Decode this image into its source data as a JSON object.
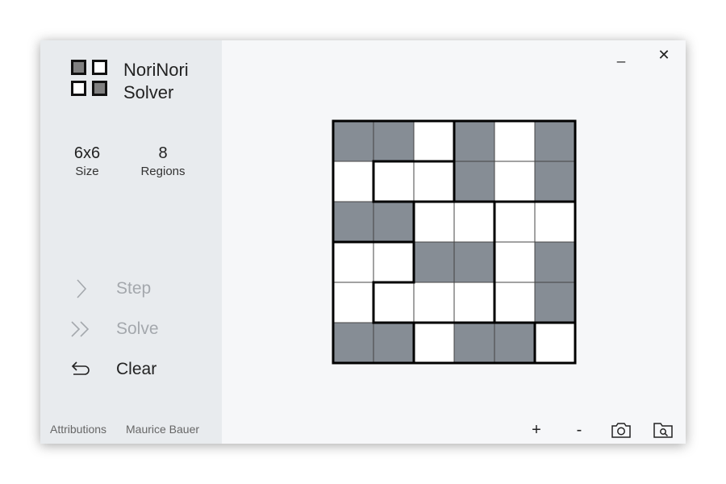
{
  "app": {
    "title_line1": "NoriNori",
    "title_line2": "Solver",
    "logo_icon": "grid-logo-icon"
  },
  "stats": {
    "size_value": "6x6",
    "size_label": "Size",
    "regions_value": "8",
    "regions_label": "Regions"
  },
  "actions": [
    {
      "label": "Step",
      "icon": "chevron-right-icon",
      "enabled": false
    },
    {
      "label": "Solve",
      "icon": "double-chevron-right-icon",
      "enabled": false
    },
    {
      "label": "Clear",
      "icon": "undo-arrow-icon",
      "enabled": true
    }
  ],
  "footer": {
    "attributions": "Attributions",
    "author": "Maurice Bauer"
  },
  "window_controls": {
    "minimize": "_",
    "close": "✕"
  },
  "toolbar": {
    "zoom_in": "+",
    "zoom_out": "-",
    "screenshot_icon": "camera-icon",
    "open_icon": "folder-search-icon"
  },
  "colors": {
    "filled": "#868d95",
    "empty": "#ffffff",
    "grid_line": "#444444",
    "region_border": "#000000",
    "sidebar_bg": "#e8ebee",
    "main_bg": "#f6f7f9",
    "disabled_text": "#a4a8ad"
  },
  "board": {
    "rows": 6,
    "cols": 6,
    "cells": [
      [
        1,
        1,
        0,
        1,
        0,
        1
      ],
      [
        0,
        0,
        0,
        1,
        0,
        1
      ],
      [
        1,
        1,
        0,
        0,
        0,
        0
      ],
      [
        0,
        0,
        1,
        1,
        0,
        1
      ],
      [
        0,
        0,
        0,
        0,
        0,
        1
      ],
      [
        1,
        1,
        0,
        1,
        1,
        0
      ]
    ],
    "regions": [
      [
        0,
        0,
        0,
        1,
        1,
        1
      ],
      [
        0,
        2,
        2,
        1,
        1,
        1
      ],
      [
        0,
        0,
        3,
        3,
        4,
        4
      ],
      [
        5,
        5,
        3,
        3,
        4,
        4
      ],
      [
        5,
        3,
        3,
        3,
        4,
        4
      ],
      [
        5,
        5,
        6,
        6,
        6,
        7
      ]
    ]
  }
}
